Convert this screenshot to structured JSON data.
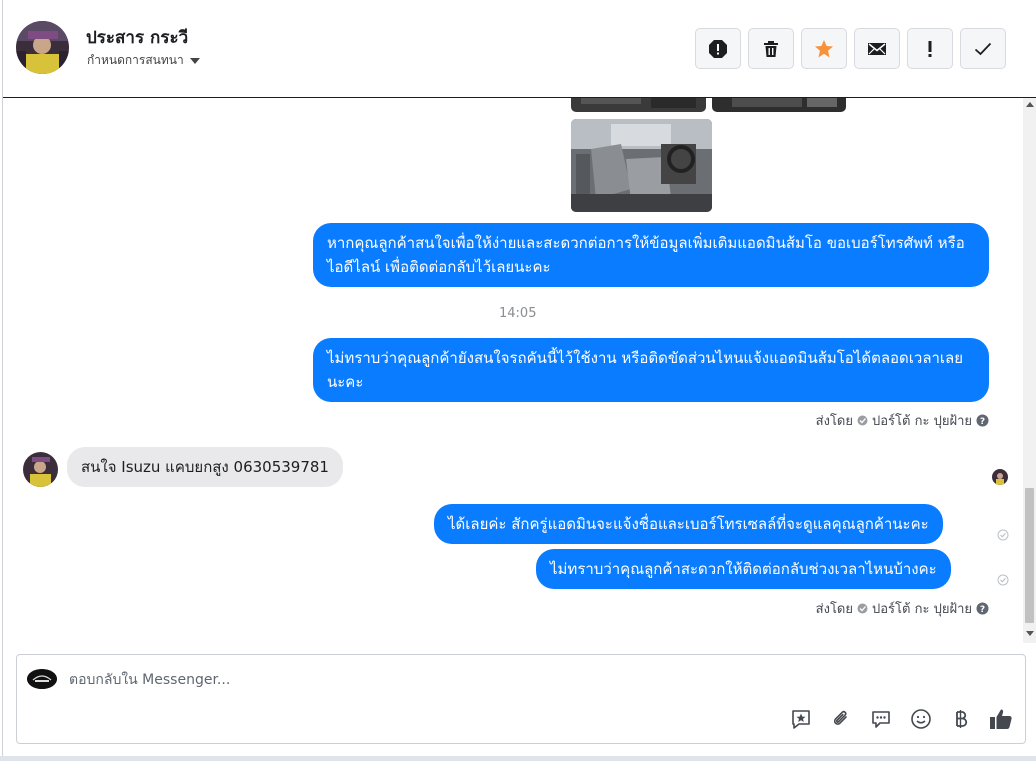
{
  "header": {
    "contact_name": "ประสาร กระวี",
    "settings_label": "กำหนดการสนทนา",
    "toolbar": [
      {
        "name": "report-icon"
      },
      {
        "name": "trash-icon"
      },
      {
        "name": "star-icon",
        "color": "#f7923a"
      },
      {
        "name": "mail-icon"
      },
      {
        "name": "important-icon"
      },
      {
        "name": "check-icon"
      }
    ]
  },
  "thread": {
    "messages_out_1": "หากคุณลูกค้าสนใจเพื่อให้ง่ายและสะดวกต่อการให้ข้อมูลเพิ่มเติมแอดมินส้มโอ ขอเบอร์โทรศัพท์ หรือ ไอดีไลน์ เพื่อติดต่อกลับไว้เลยนะคะ",
    "timestamp": "14:05",
    "messages_out_2": "ไม่ทราบว่าคุณลูกค้ายังสนใจรถคันนี้ไว้ใช้งาน หรือติดขัดส่วนไหนแจ้งแอดมินส้มโอได้ตลอดเวลาเลยนะคะ",
    "sent_by_prefix": "ส่งโดย",
    "sent_by_name": "ปอร์โต้ กะ ปุยฝ้าย",
    "message_in": "สนใจ Isuzu แคบยกสูง 0630539781",
    "messages_out_3": "ได้เลยค่ะ สักครู่แอดมินจะแจ้งชื่อและเบอร์โทรเซลล์ที่จะดูแลคุณลูกค้านะคะ",
    "messages_out_4": "ไม่ทราบว่าคุณลูกค้าสะดวกให้ติดต่อกลับช่วงเวลาไหนบ้างคะ"
  },
  "composer": {
    "placeholder": "ตอบกลับใน Messenger...",
    "tools": [
      "saved-reply-icon",
      "attachment-icon",
      "chat-bubbles-icon",
      "emoji-icon",
      "baht-icon",
      "like-icon"
    ]
  },
  "colors": {
    "outgoing_bubble": "#0a7cff",
    "incoming_bubble": "#e9e9eb"
  }
}
